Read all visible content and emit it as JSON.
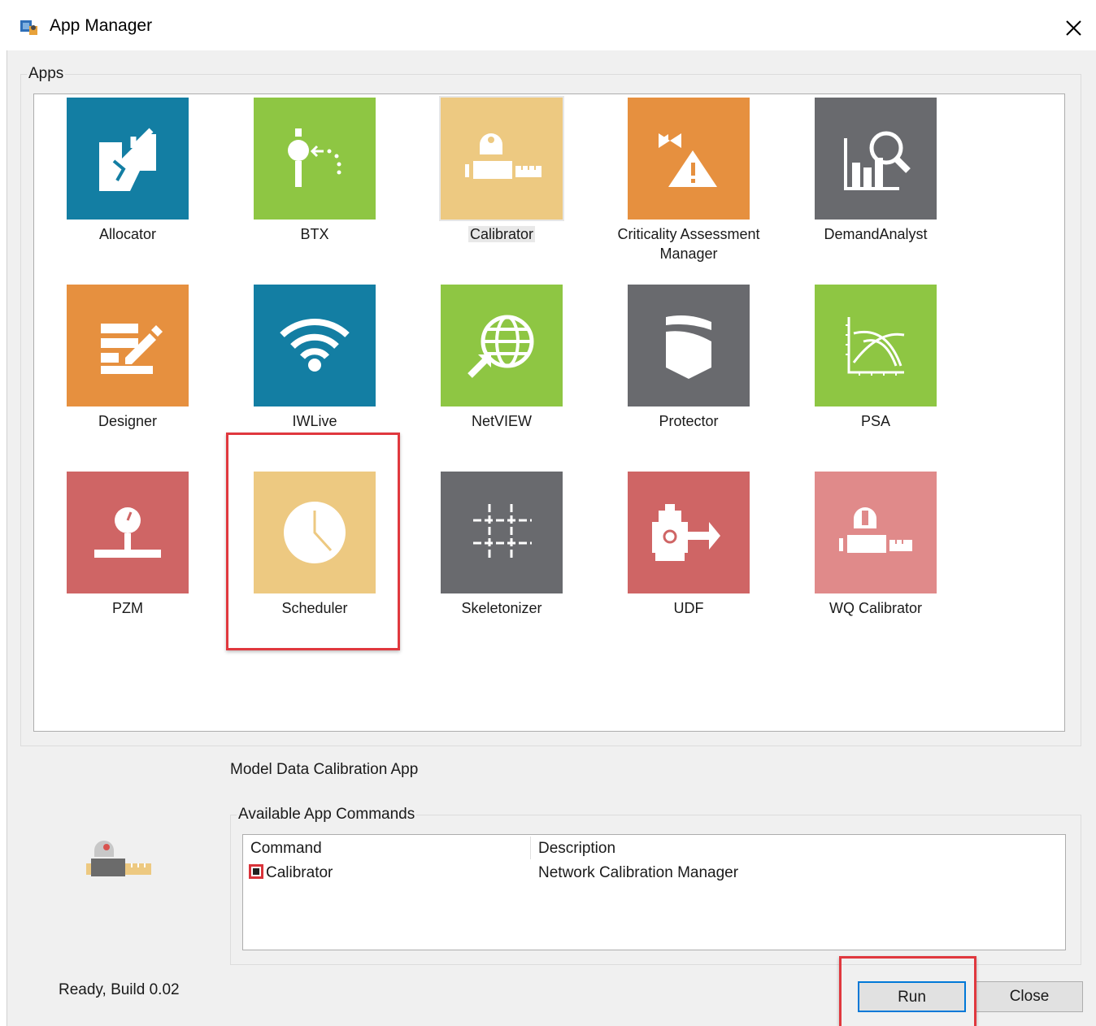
{
  "window": {
    "title": "App Manager",
    "close_glyph": "✕"
  },
  "apps_group": {
    "label": "Apps",
    "tiles": [
      {
        "label": "Allocator",
        "color": "#137ea3",
        "icon": "allocator-icon"
      },
      {
        "label": "BTX",
        "color": "#8ec643",
        "icon": "btx-icon"
      },
      {
        "label": "Calibrator",
        "color": "#edc981",
        "icon": "calibrator-icon",
        "selected": true
      },
      {
        "label": "Criticality Assessment Manager",
        "color": "#e6903f",
        "icon": "criticality-icon"
      },
      {
        "label": "DemandAnalyst",
        "color": "#696a6e",
        "icon": "demand-analyst-icon"
      },
      {
        "label": "Designer",
        "color": "#e6903f",
        "icon": "designer-icon"
      },
      {
        "label": "IWLive",
        "color": "#137ea3",
        "icon": "wifi-icon"
      },
      {
        "label": "NetVIEW",
        "color": "#8ec643",
        "icon": "globe-icon"
      },
      {
        "label": "Protector",
        "color": "#696a6e",
        "icon": "shield-icon"
      },
      {
        "label": "PSA",
        "color": "#8ec643",
        "icon": "curve-chart-icon"
      },
      {
        "label": "PZM",
        "color": "#cf6565",
        "icon": "pressure-gauge-icon"
      },
      {
        "label": "Scheduler",
        "color": "#edc981",
        "icon": "clock-icon"
      },
      {
        "label": "Skeletonizer",
        "color": "#696a6e",
        "icon": "grid-icon"
      },
      {
        "label": "UDF",
        "color": "#cf6565",
        "icon": "hydrant-icon"
      },
      {
        "label": "WQ Calibrator",
        "color": "#e08a8a",
        "icon": "wq-calibrator-icon"
      }
    ]
  },
  "selected_app": {
    "description": "Model Data Calibration App"
  },
  "commands_group": {
    "label": "Available App Commands",
    "columns": [
      "Command",
      "Description"
    ],
    "rows": [
      {
        "command": "Calibrator",
        "description": "Network Calibration Manager"
      }
    ]
  },
  "status": "Ready, Build 0.02",
  "buttons": {
    "run": "Run",
    "close": "Close"
  },
  "highlight_color": "#e0383e"
}
